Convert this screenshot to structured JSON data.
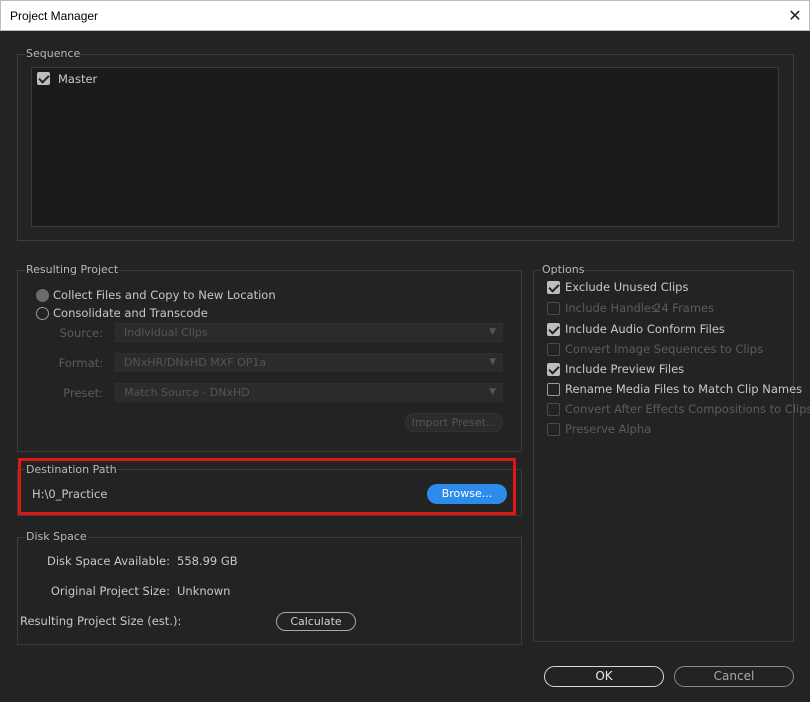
{
  "window": {
    "title": "Project Manager",
    "close_glyph": "✕"
  },
  "sequence": {
    "label": "Sequence",
    "items": [
      {
        "label": "Master",
        "checked": true
      }
    ]
  },
  "resulting_project": {
    "label": "Resulting Project",
    "collect_label": "Collect Files and Copy to New Location",
    "consolidate_label": "Consolidate and Transcode",
    "source_label": "Source:",
    "source_value": "Individual Clips",
    "format_label": "Format:",
    "format_value": "DNxHR/DNxHD MXF OP1a",
    "preset_label": "Preset:",
    "preset_value": "Match Source - DNxHD",
    "import_preset_label": "Import Preset..."
  },
  "destination": {
    "label": "Destination Path",
    "path": "H:\\0_Practice",
    "browse_label": "Browse..."
  },
  "disk_space": {
    "label": "Disk Space",
    "available_label": "Disk Space Available:",
    "available_value": "558.99 GB",
    "original_label": "Original Project Size:",
    "original_value": "Unknown",
    "resulting_label": "Resulting Project Size (est.):",
    "calculate_label": "Calculate"
  },
  "options": {
    "label": "Options",
    "items": [
      {
        "label": "Exclude Unused Clips",
        "checked": true,
        "enabled": true
      },
      {
        "label": "Include Handles:",
        "extra": "24 Frames",
        "checked": false,
        "enabled": false
      },
      {
        "label": "Include Audio Conform Files",
        "checked": true,
        "enabled": true
      },
      {
        "label": "Convert Image Sequences to Clips",
        "checked": false,
        "enabled": false
      },
      {
        "label": "Include Preview Files",
        "checked": true,
        "enabled": true
      },
      {
        "label": "Rename Media Files to Match Clip Names",
        "checked": false,
        "enabled": true
      },
      {
        "label": "Convert After Effects Compositions to Clips",
        "checked": false,
        "enabled": false
      },
      {
        "label": "Preserve Alpha",
        "checked": false,
        "enabled": false
      }
    ]
  },
  "footer": {
    "ok_label": "OK",
    "cancel_label": "Cancel"
  },
  "colors": {
    "accent": "#2d8ceb",
    "highlight": "#e01616",
    "background": "#232323"
  }
}
